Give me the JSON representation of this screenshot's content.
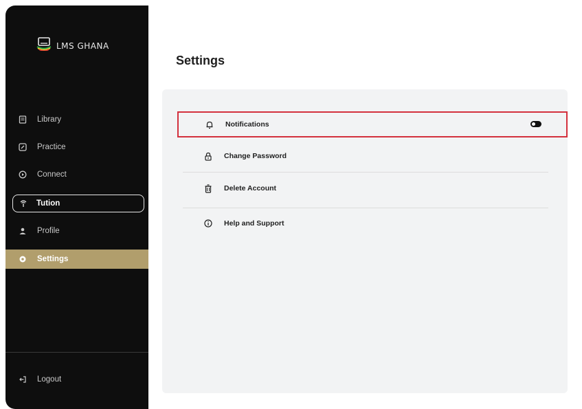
{
  "brand": {
    "name": "LMS GHANA",
    "icon": "laptop-logo-icon",
    "accent": "#b19e6c"
  },
  "sidebar": {
    "items": [
      {
        "label": "Library",
        "icon": "book-icon"
      },
      {
        "label": "Practice",
        "icon": "edit-icon"
      },
      {
        "label": "Connect",
        "icon": "play-circle-icon"
      },
      {
        "label": "Tution",
        "icon": "antenna-icon"
      },
      {
        "label": "Profile",
        "icon": "user-icon"
      },
      {
        "label": "Settings",
        "icon": "gear-icon"
      }
    ],
    "logout": {
      "label": "Logout",
      "icon": "logout-icon"
    }
  },
  "main": {
    "title": "Settings",
    "settings": [
      {
        "label": "Notifications",
        "icon": "bell-icon"
      },
      {
        "label": "Change Password",
        "icon": "lock-icon"
      },
      {
        "label": "Delete Account",
        "icon": "trash-icon"
      },
      {
        "label": "Help and Support",
        "icon": "info-icon"
      }
    ]
  },
  "colors": {
    "sidebar_bg": "#0e0e0e",
    "active_bg": "#b19e6c",
    "highlight_border": "#d32f3c"
  }
}
